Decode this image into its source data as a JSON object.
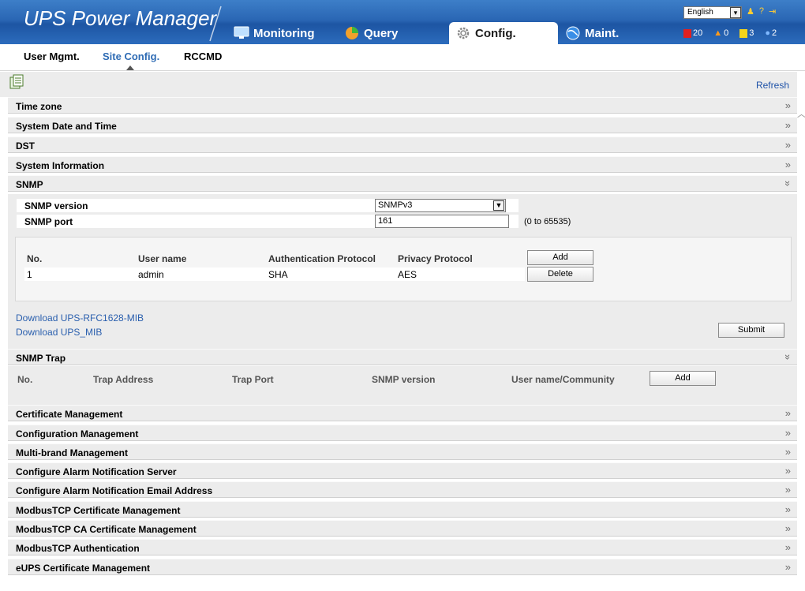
{
  "header": {
    "app_title": "UPS Power Manager",
    "tabs": [
      {
        "label": "Monitoring"
      },
      {
        "label": "Query"
      },
      {
        "label": "Config."
      },
      {
        "label": "Maint."
      }
    ],
    "language": "English",
    "alarms": {
      "critical": "20",
      "major": "0",
      "minor": "3",
      "warning": "2"
    }
  },
  "subnav": {
    "items": [
      {
        "label": "User Mgmt."
      },
      {
        "label": "Site Config."
      },
      {
        "label": "RCCMD"
      }
    ]
  },
  "toolbar": {
    "refresh_label": "Refresh"
  },
  "sections": {
    "time_zone": "Time zone",
    "system_date": "System Date and Time",
    "dst": "DST",
    "system_info": "System Information",
    "snmp": "SNMP",
    "snmp_trap": "SNMP Trap",
    "cert_mgmt": "Certificate Management",
    "config_mgmt": "Configuration Management",
    "multibrand": "Multi-brand Management",
    "alarm_server": "Configure Alarm Notification Server",
    "alarm_email": "Configure Alarm Notification Email Address",
    "modbus_cert": "ModbusTCP Certificate Management",
    "modbus_ca": "ModbusTCP CA Certificate Management",
    "modbus_auth": "ModbusTCP Authentication",
    "eups_cert": "eUPS Certificate Management"
  },
  "snmp": {
    "version_label": "SNMP version",
    "version_value": "SNMPv3",
    "port_label": "SNMP port",
    "port_value": "161",
    "port_hint": "(0 to 65535)",
    "users_columns": [
      "No.",
      "User name",
      "Authentication Protocol",
      "Privacy Protocol"
    ],
    "users": [
      {
        "no": "1",
        "name": "admin",
        "auth": "SHA",
        "privacy": "AES"
      }
    ],
    "add_label": "Add",
    "delete_label": "Delete",
    "download_rfc": "Download UPS-RFC1628-MIB",
    "download_mib": "Download UPS_MIB",
    "submit_label": "Submit"
  },
  "trap": {
    "columns": [
      "No.",
      "Trap Address",
      "Trap Port",
      "SNMP version",
      "User name/Community"
    ],
    "add_label": "Add"
  },
  "colors": {
    "header_blue": "#2a66b4",
    "link_blue": "#2a5fae",
    "panel_gray": "#ececec"
  }
}
